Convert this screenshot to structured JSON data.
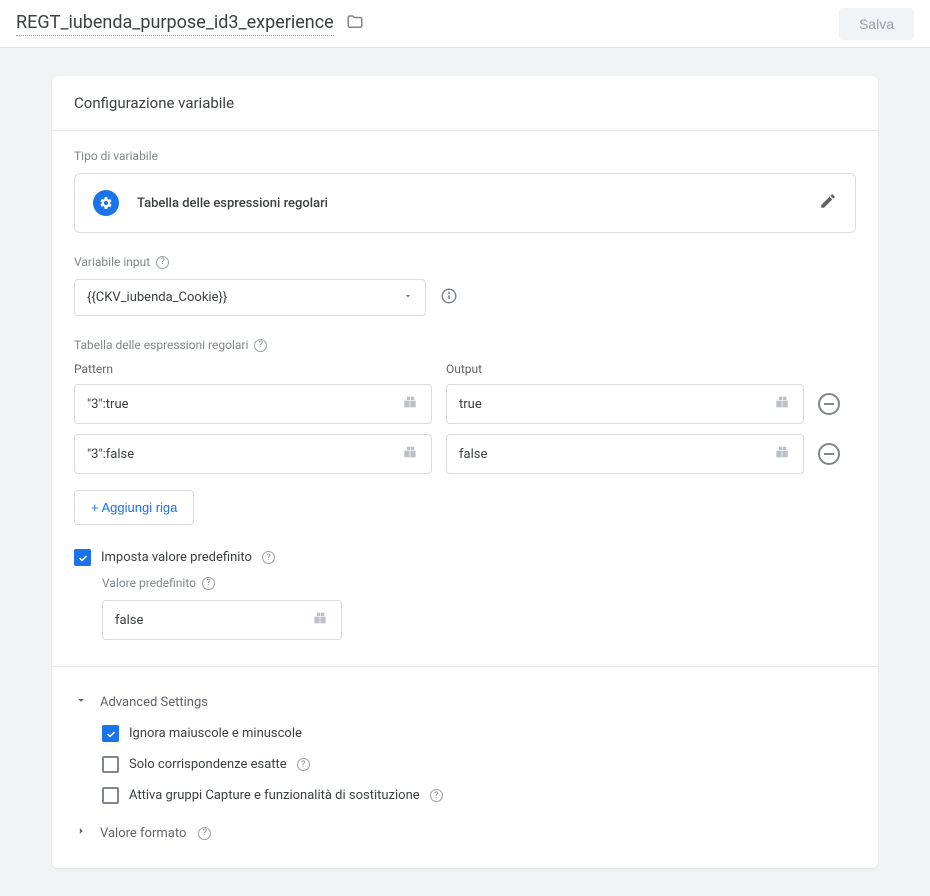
{
  "header": {
    "title": "REGT_iubenda_purpose_id3_experience",
    "save": "Salva"
  },
  "card": {
    "title": "Configurazione variabile",
    "typeLabel": "Tipo di variabile",
    "typeName": "Tabella delle espressioni regolari",
    "inputVarLabel": "Variabile input",
    "inputVarValue": "{{CKV_iubenda_Cookie}}",
    "tableLabel": "Tabella delle espressioni regolari",
    "patternLabel": "Pattern",
    "outputLabel": "Output",
    "rows": [
      {
        "pattern": "\"3\":true",
        "output": "true"
      },
      {
        "pattern": "\"3\":false",
        "output": "false"
      }
    ],
    "addRow": "+ Aggiungi riga",
    "setDefault": "Imposta valore predefinito",
    "defaultLabel": "Valore predefinito",
    "defaultValue": "false",
    "advanced": {
      "heading": "Advanced Settings",
      "ignoreCase": "Ignora maiuscole e minuscole",
      "exactOnly": "Solo corrispondenze esatte",
      "captureGroups": "Attiva gruppi Capture e funzionalità di sostituzione"
    },
    "valueFormat": "Valore formato"
  }
}
